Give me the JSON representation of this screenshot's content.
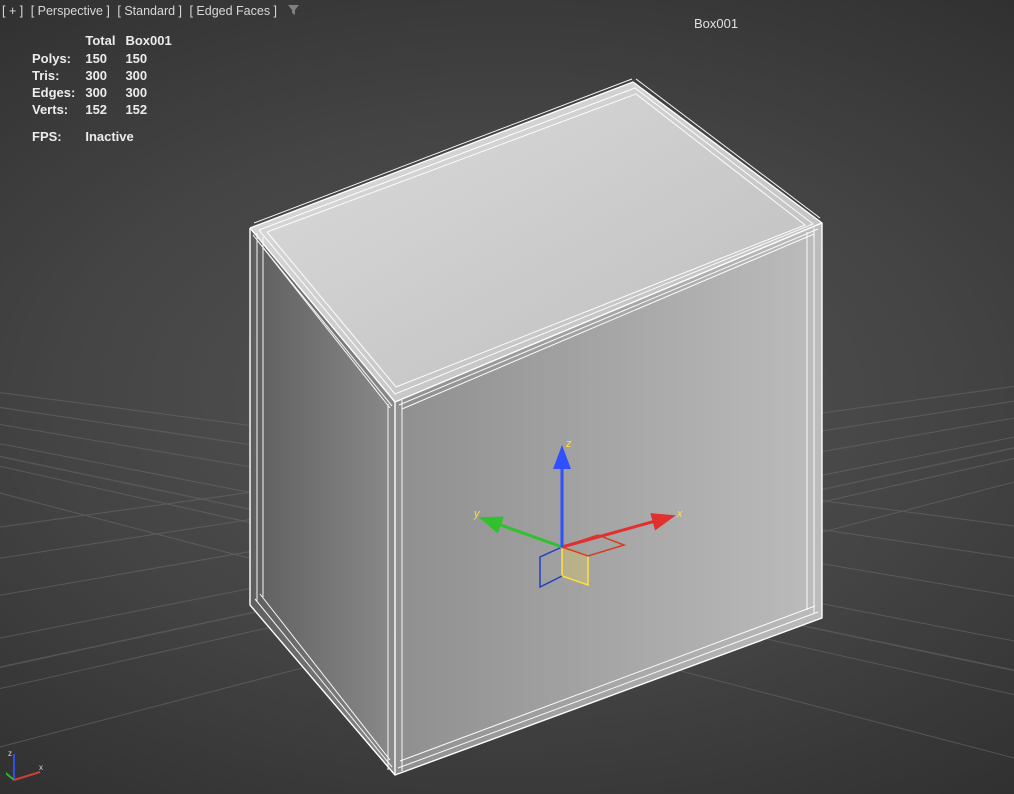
{
  "viewlabels": {
    "expand": "[ + ]",
    "view": "[ Perspective ]",
    "shading": "[ Standard ]",
    "edged": "[ Edged Faces ]"
  },
  "object_name": "Box001",
  "stats": {
    "columns": [
      "",
      "Total",
      "Box001"
    ],
    "rows": [
      {
        "label": "Polys:",
        "total": "150",
        "obj": "150"
      },
      {
        "label": "Tris:",
        "total": "300",
        "obj": "300"
      },
      {
        "label": "Edges:",
        "total": "300",
        "obj": "300"
      },
      {
        "label": "Verts:",
        "total": "152",
        "obj": "152"
      }
    ],
    "fps_label": "FPS:",
    "fps_value": "Inactive"
  },
  "gizmo": {
    "axes": {
      "x": "x",
      "y": "y",
      "z": "z"
    },
    "colors": {
      "x": "#e03030",
      "y": "#30c030",
      "z": "#3050ff",
      "highlight": "#ffe040"
    }
  },
  "colors": {
    "wire_selected": "#ffffff",
    "face_top": "#c9c9c9",
    "face_front": "#a6a6a6",
    "face_left": "#7a7a7a",
    "grid": "#6e6e6e"
  }
}
